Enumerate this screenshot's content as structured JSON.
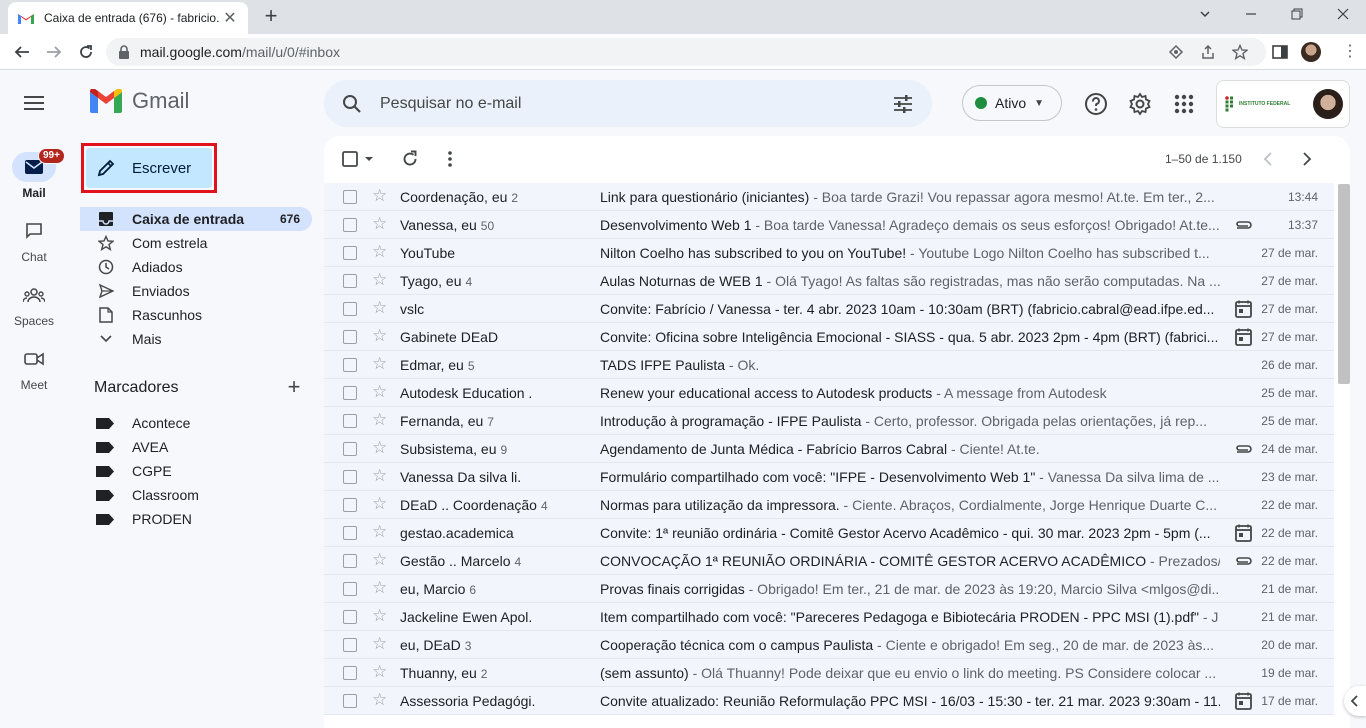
{
  "browser": {
    "tab_title": "Caixa de entrada (676) - fabricio.",
    "url_host": "mail.google.com",
    "url_path": "/mail/u/0/#inbox"
  },
  "rail": {
    "mail_label": "Mail",
    "mail_badge": "99+",
    "chat_label": "Chat",
    "spaces_label": "Spaces",
    "meet_label": "Meet"
  },
  "app": {
    "name": "Gmail",
    "compose_label": "Escrever"
  },
  "nav": [
    {
      "label": "Caixa de entrada",
      "count": "676",
      "icon": "inbox-icon"
    },
    {
      "label": "Com estrela",
      "count": "",
      "icon": "star-icon"
    },
    {
      "label": "Adiados",
      "count": "",
      "icon": "clock-icon"
    },
    {
      "label": "Enviados",
      "count": "",
      "icon": "send-icon"
    },
    {
      "label": "Rascunhos",
      "count": "",
      "icon": "draft-icon"
    },
    {
      "label": "Mais",
      "count": "",
      "icon": "chevron-down-icon"
    }
  ],
  "labels": {
    "title": "Marcadores",
    "items": [
      "Acontece",
      "AVEA",
      "CGPE",
      "Classroom",
      "PRODEN"
    ]
  },
  "search": {
    "placeholder": "Pesquisar no e-mail"
  },
  "status": {
    "label": "Ativo",
    "color": "#1e8e3e"
  },
  "account": {
    "org_text": "INSTITUTO FEDERAL"
  },
  "list": {
    "pager": "1–50 de 1.150",
    "rows": [
      {
        "sender": "Coordenação, eu",
        "count": "2",
        "subject": "Link para questionário (iniciantes)",
        "snippet": " - Boa tarde Grazi! Vou repassar agora mesmo! At.te. Em ter., 2...",
        "attachment": "",
        "date": "13:44"
      },
      {
        "sender": "Vanessa, eu",
        "count": "50",
        "subject": "Desenvolvimento Web 1",
        "snippet": " - Boa tarde Vanessa! Agradeço demais os seus esforços! Obrigado! At.te...",
        "attachment": "clip",
        "date": "13:37"
      },
      {
        "sender": "YouTube",
        "count": "",
        "subject": "Nilton Coelho has subscribed to you on YouTube!",
        "snippet": " - Youtube Logo Nilton Coelho has subscribed t...",
        "attachment": "",
        "date": "27 de mar."
      },
      {
        "sender": "Tyago, eu",
        "count": "4",
        "subject": "Aulas Noturnas de WEB 1",
        "snippet": " - Olá Tyago! As faltas são registradas, mas não serão computadas. Na ...",
        "attachment": "",
        "date": "27 de mar."
      },
      {
        "sender": "vslc",
        "count": "",
        "subject": "Convite: Fabrício / Vanessa - ter. 4 abr. 2023 10am - 10:30am (BRT) (fabricio.cabral@ead.ifpe.ed...",
        "snippet": "",
        "attachment": "calendar",
        "date": "27 de mar."
      },
      {
        "sender": "Gabinete DEaD",
        "count": "",
        "subject": "Convite: Oficina sobre Inteligência Emocional - SIASS - qua. 5 abr. 2023 2pm - 4pm (BRT) (fabrici...",
        "snippet": "",
        "attachment": "calendar",
        "date": "27 de mar."
      },
      {
        "sender": "Edmar, eu",
        "count": "5",
        "subject": "TADS IFPE Paulista",
        "snippet": " - Ok.",
        "attachment": "",
        "date": "26 de mar."
      },
      {
        "sender": "Autodesk Education .",
        "count": "",
        "subject": "Renew your educational access to Autodesk products",
        "snippet": " - A message from Autodesk",
        "attachment": "",
        "date": "25 de mar."
      },
      {
        "sender": "Fernanda, eu",
        "count": "7",
        "subject": "Introdução à programação - IFPE Paulista",
        "snippet": " - Certo, professor. Obrigada pelas orientações, já rep...",
        "attachment": "",
        "date": "25 de mar."
      },
      {
        "sender": "Subsistema, eu",
        "count": "9",
        "subject": "Agendamento de Junta Médica - Fabrício Barros Cabral",
        "snippet": " - Ciente! At.te.",
        "attachment": "clip",
        "date": "24 de mar."
      },
      {
        "sender": "Vanessa Da silva li.",
        "count": "",
        "subject": "Formulário compartilhado com você: \"IFPE - Desenvolvimento Web 1\"",
        "snippet": " - Vanessa Da silva lima de ...",
        "attachment": "",
        "date": "23 de mar."
      },
      {
        "sender": "DEaD .. Coordenação",
        "count": "4",
        "subject": "Normas para utilização da impressora.",
        "snippet": " - Ciente. Abraços, Cordialmente, Jorge Henrique Duarte C...",
        "attachment": "",
        "date": "22 de mar."
      },
      {
        "sender": "gestao.academica",
        "count": "",
        "subject": "Convite: 1ª reunião ordinária - Comitê Gestor Acervo Acadêmico - qui. 30 mar. 2023 2pm - 5pm (...",
        "snippet": "",
        "attachment": "calendar",
        "date": "22 de mar."
      },
      {
        "sender": "Gestão .. Marcelo",
        "count": "4",
        "subject": "CONVOCAÇÃO 1ª REUNIÃO ORDINÁRIA - COMITÊ GESTOR ACERVO ACADÊMICO",
        "snippet": " - Prezados/as ...",
        "attachment": "clip",
        "date": "22 de mar."
      },
      {
        "sender": "eu, Marcio",
        "count": "6",
        "subject": "Provas finais corrigidas",
        "snippet": " - Obrigado! Em ter., 21 de mar. de 2023 às 19:20, Marcio Silva <mlgos@di...",
        "attachment": "",
        "date": "21 de mar."
      },
      {
        "sender": "Jackeline Ewen Apol.",
        "count": "",
        "subject": "Item compartilhado com você: \"Pareceres Pedagoga e Bibiotecária PRODEN - PPC MSI (1).pdf\"",
        "snippet": " - J",
        "attachment": "",
        "date": "21 de mar."
      },
      {
        "sender": "eu, DEaD",
        "count": "3",
        "subject": "Cooperação técnica com o campus Paulista",
        "snippet": " - Ciente e obrigado! Em seg., 20 de mar. de 2023 às...",
        "attachment": "",
        "date": "20 de mar."
      },
      {
        "sender": "Thuanny, eu",
        "count": "2",
        "subject": "(sem assunto)",
        "snippet": " - Olá Thuanny! Pode deixar que eu envio o link do meeting. PS Considere colocar ...",
        "attachment": "",
        "date": "19 de mar."
      },
      {
        "sender": "Assessoria Pedagógi.",
        "count": "",
        "subject": "Convite atualizado: Reunião Reformulação PPC MSI - 16/03 - 15:30 - ter. 21 mar. 2023 9:30am - 11...",
        "snippet": "",
        "attachment": "calendar",
        "date": "17 de mar."
      }
    ]
  }
}
